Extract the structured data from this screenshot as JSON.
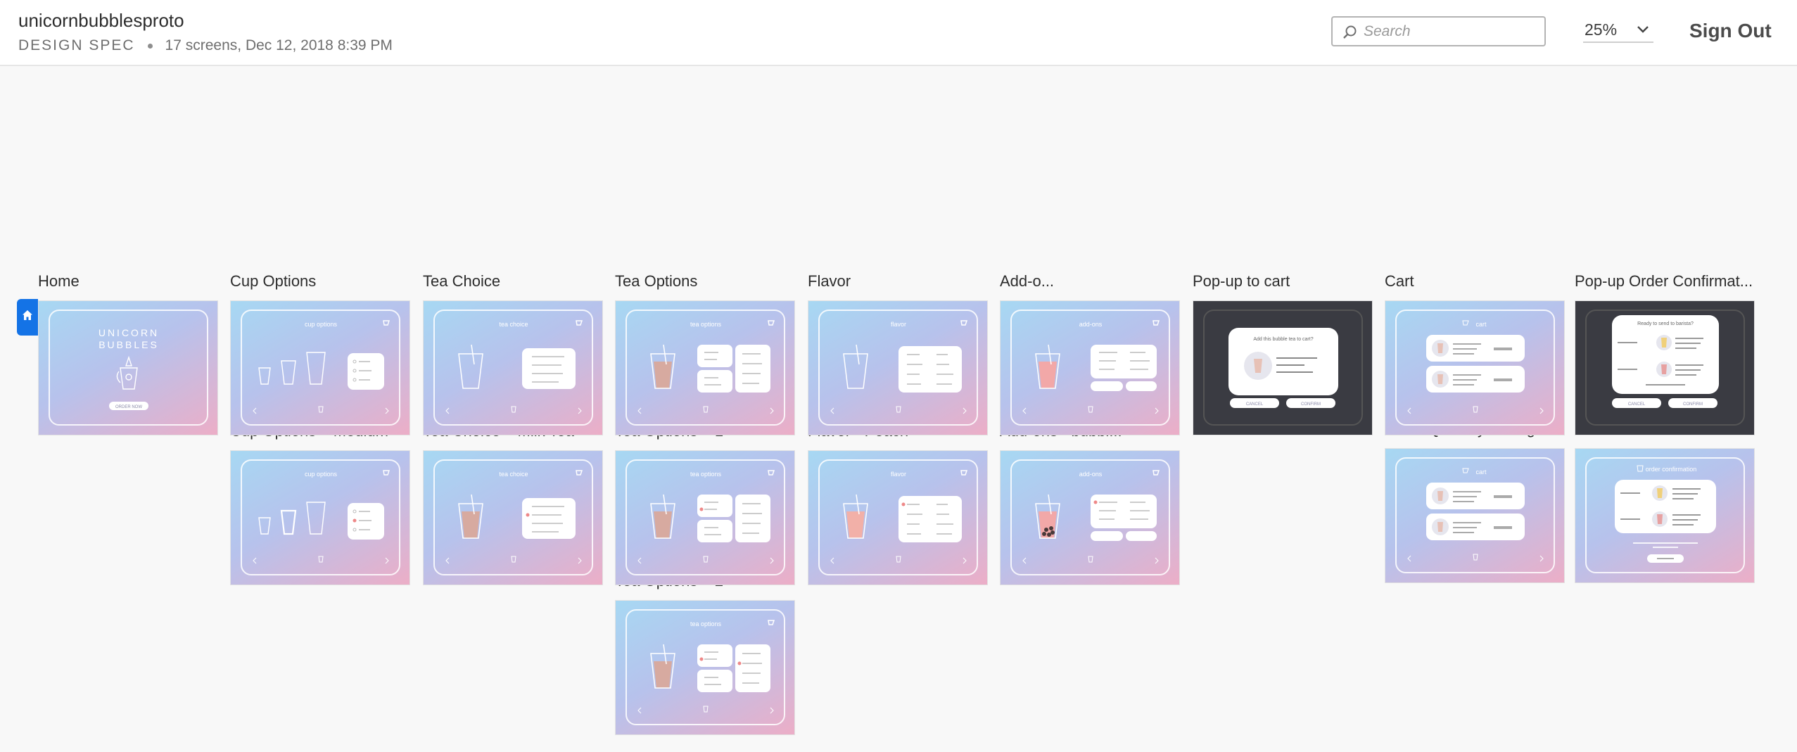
{
  "header": {
    "project_name": "unicornbubblesproto",
    "doc_type": "DESIGN SPEC",
    "meta": "17 screens, Dec 12, 2018 8:39 PM",
    "search_placeholder": "Search",
    "zoom": "25%",
    "sign_out": "Sign Out"
  },
  "screens": [
    {
      "label": "Home"
    },
    {
      "label": "Cup Options"
    },
    {
      "label": "Tea Choice"
    },
    {
      "label": "Tea Options"
    },
    {
      "label": "Flavor"
    },
    {
      "label": "Add-o..."
    },
    {
      "label": "Pop-up to cart"
    },
    {
      "label": "Cart"
    },
    {
      "label": "Pop-up Order Confirmat..."
    },
    {
      "label": "Cup Options – Medium"
    },
    {
      "label": "Tea Choice – Milk Tea"
    },
    {
      "label": "Tea Options – 1"
    },
    {
      "label": "Flavor - Peach"
    },
    {
      "label": "Add-ons - bubbl..."
    },
    {
      "label": "Cart - Quantity Change"
    },
    {
      "label": "Tea Options – 2"
    }
  ],
  "thumb_text": {
    "unicorn": "UNICORN",
    "bubbles": "BUBBLES",
    "order_now": "ORDER NOW",
    "cup_options": "cup options",
    "tea_choice": "tea choice",
    "tea_options": "tea options",
    "flavor": "flavor",
    "addons": "add-ons",
    "cart": "cart",
    "order_confirmation": "order confirmation",
    "popup_cart_title": "Add this bubble tea to cart?",
    "popup_order_title": "Ready to send to barista?",
    "cancel": "CANCEL",
    "confirm": "CONFIRM"
  },
  "colors": {
    "accent": "#1473e6",
    "gradient_blue": "#a7d8f3",
    "gradient_pink": "#ecaec7",
    "dark_overlay": "#3a3b42"
  }
}
